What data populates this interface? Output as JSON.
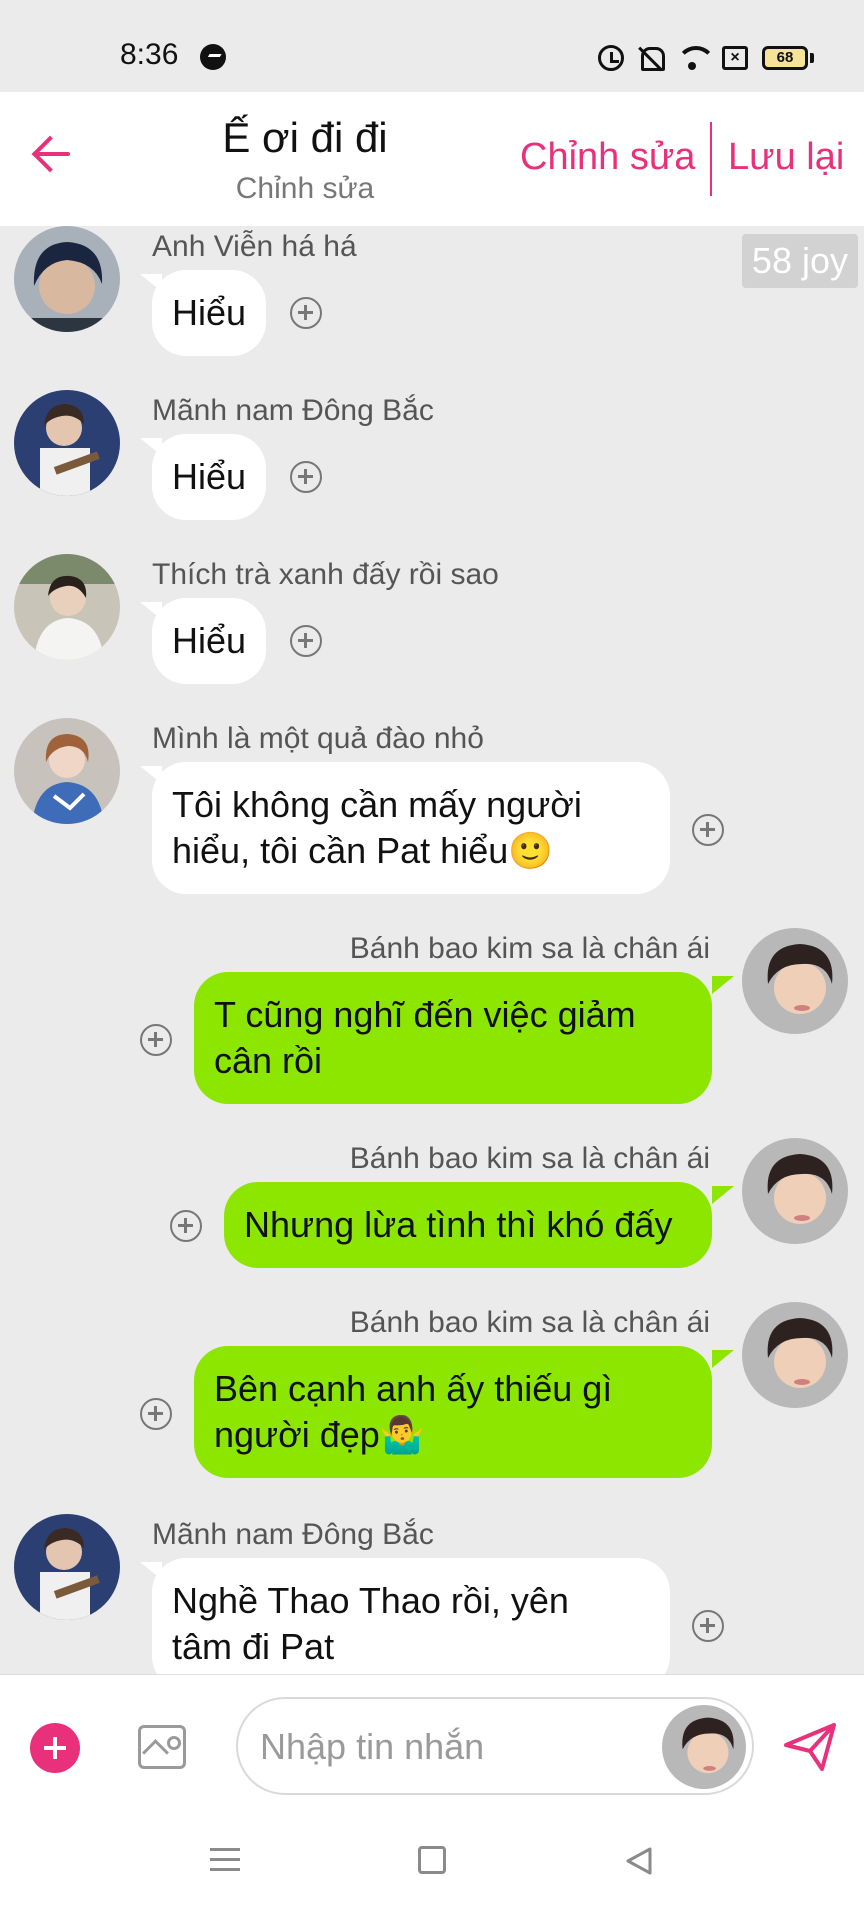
{
  "status_bar": {
    "time": "8:36",
    "battery": "68",
    "icons": [
      "messenger-icon",
      "alarm-icon",
      "bell-off-icon",
      "wifi-icon",
      "sim-off-icon",
      "battery-icon"
    ]
  },
  "header": {
    "title": "Ế ơi đi đi",
    "subtitle": "Chỉnh sửa",
    "edit_label": "Chỉnh sửa",
    "save_label": "Lưu lại"
  },
  "chat": {
    "badge": "58 joy",
    "messages": [
      {
        "side": "in",
        "sender": "Anh Viễn há há",
        "text": "Hiểu"
      },
      {
        "side": "in",
        "sender": "Mãnh nam Đông Bắc",
        "text": "Hiểu"
      },
      {
        "side": "in",
        "sender": "Thích trà xanh đấy rồi sao",
        "text": "Hiểu"
      },
      {
        "side": "in",
        "sender": "Mình là một quả đào nhỏ",
        "line1": "Tôi không cần mấy người",
        "line2": "hiểu, tôi cần Pat hiểu",
        "emoji": "🙂"
      },
      {
        "side": "out",
        "sender": "Bánh bao kim sa là chân ái",
        "line1": "T cũng nghĩ đến việc giảm",
        "line2": "cân rồi"
      },
      {
        "side": "out",
        "sender": "Bánh bao kim sa là chân ái",
        "text": "Nhưng lừa tình thì khó đấy"
      },
      {
        "side": "out",
        "sender": "Bánh bao kim sa là chân ái",
        "line1": "Bên cạnh anh ấy thiếu gì",
        "line2": "người đẹp",
        "emoji": "🤷‍♂️"
      },
      {
        "side": "in",
        "sender": "Mãnh nam Đông Bắc",
        "line1": "Nghề Thao Thao rồi, yên",
        "line2": "tâm đi Pat"
      }
    ]
  },
  "composer": {
    "placeholder": "Nhập tin nhắn"
  },
  "colors": {
    "accent": "#e8317a",
    "outgoing_bubble": "#8ce600",
    "incoming_bubble": "#ffffff",
    "chat_background": "#ebebeb"
  }
}
